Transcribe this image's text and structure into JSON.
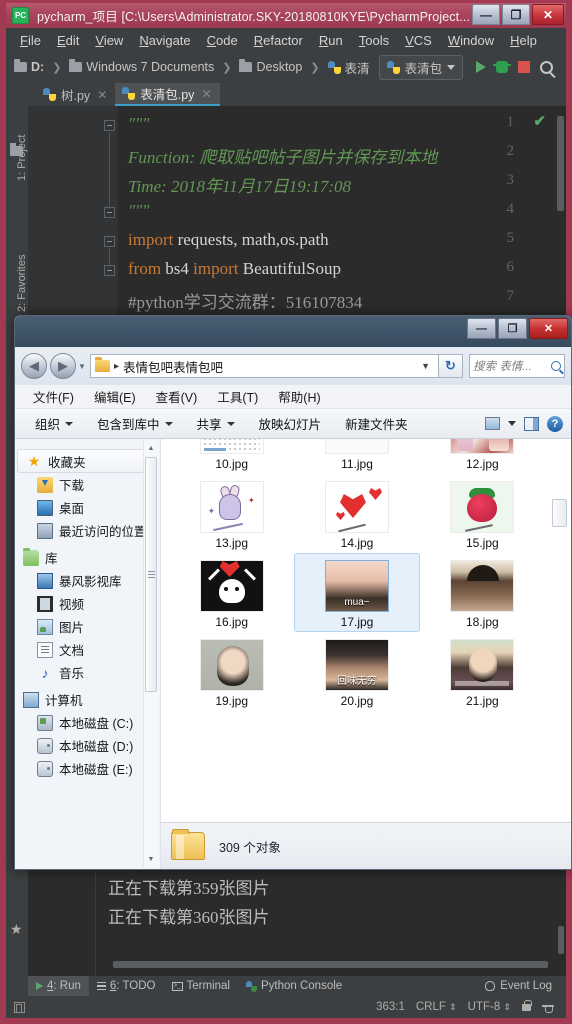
{
  "pycharm": {
    "title": "pycharm_项目 [C:\\Users\\Administrator.SKY-20180810KYE\\PycharmProject...",
    "logo_text": "PC",
    "window_buttons": {
      "minimize": "—",
      "maximize": "❐",
      "close": "✕"
    },
    "menu": [
      "File",
      "Edit",
      "View",
      "Navigate",
      "Code",
      "Refactor",
      "Run",
      "Tools",
      "VCS",
      "Window",
      "Help"
    ],
    "breadcrumbs": [
      "D:",
      "Windows 7 Documents",
      "Desktop",
      "表清"
    ],
    "run_config": "表清包",
    "toolbar_icons": [
      "run-icon",
      "debug-icon",
      "stop-icon",
      "search-everywhere-icon"
    ],
    "tabs": [
      {
        "label": "树.py",
        "active": false
      },
      {
        "label": "表清包.py",
        "active": true
      }
    ],
    "left_strip": {
      "project_label": "1: Project",
      "favorites_label": "2: Favorites"
    },
    "editor": {
      "line_numbers": [
        "1",
        "2",
        "3",
        "4",
        "5",
        "6",
        "7"
      ],
      "lines": [
        {
          "num": "1",
          "segments": [
            {
              "text": "\"\"\"",
              "cls": "c-doc"
            }
          ]
        },
        {
          "num": "2",
          "segments": [
            {
              "text": "Function: 爬取贴吧帖子图片并保存到本地",
              "cls": "c-doc"
            }
          ]
        },
        {
          "num": "3",
          "segments": [
            {
              "text": "Time: 2018年11月17日19:17:08",
              "cls": "c-doc"
            }
          ]
        },
        {
          "num": "4",
          "segments": [
            {
              "text": "\"\"\"",
              "cls": "c-doc"
            }
          ]
        },
        {
          "num": "5",
          "segments": [
            {
              "text": "import",
              "cls": "c-kw"
            },
            {
              "text": " requests, math,os.path",
              "cls": "c-plain"
            }
          ]
        },
        {
          "num": "6",
          "segments": [
            {
              "text": "from",
              "cls": "c-kw"
            },
            {
              "text": " bs4 ",
              "cls": "c-plain"
            },
            {
              "text": "import",
              "cls": "c-kw"
            },
            {
              "text": " BeautifulSoup",
              "cls": "c-plain"
            }
          ]
        },
        {
          "num": "7",
          "segments": [
            {
              "text": "#python学习交流群：516107834",
              "cls": "c-cmt"
            }
          ]
        }
      ],
      "inspection_ok": "✔"
    },
    "console": {
      "lines": [
        "正在下载第359张图片",
        "正在下载第360张图片"
      ]
    },
    "tool_windows": [
      {
        "label": "4: Run",
        "icon": "run-icon",
        "active": true
      },
      {
        "label": "6: TODO",
        "icon": "todo-icon",
        "active": false
      },
      {
        "label": "Terminal",
        "icon": "terminal-icon",
        "active": false
      },
      {
        "label": "Python Console",
        "icon": "python-icon",
        "active": false
      }
    ],
    "event_log": "Event Log",
    "status": {
      "caret": "363:1",
      "line_sep": "CRLF",
      "encoding": "UTF-8",
      "lock_icon": "lock-icon",
      "inspector_icon": "inspection-hat-icon"
    }
  },
  "explorer": {
    "window_buttons": {
      "minimize": "—",
      "maximize": "❐",
      "close": "✕"
    },
    "nav": {
      "back": "◀",
      "forward": "▶",
      "history_caret": "▼",
      "refresh": "↻"
    },
    "address": {
      "folder_icon": "folder-icon",
      "separator": "▸",
      "path": "表情包吧表情包吧",
      "caret": "▼"
    },
    "search": {
      "placeholder": "搜索 表情...",
      "icon": "search-icon"
    },
    "menu": [
      "文件(F)",
      "编辑(E)",
      "查看(V)",
      "工具(T)",
      "帮助(H)"
    ],
    "toolbar": {
      "items": [
        {
          "label": "组织",
          "caret": true
        },
        {
          "label": "包含到库中",
          "caret": true
        },
        {
          "label": "共享",
          "caret": true
        },
        {
          "label": "放映幻灯片",
          "caret": false
        },
        {
          "label": "新建文件夹",
          "caret": false
        }
      ],
      "right_icons": [
        "view-layout-icon",
        "view-caret-icon",
        "preview-pane-icon",
        "help-icon"
      ]
    },
    "sidebar": {
      "groups": [
        {
          "head": {
            "label": "收藏夹",
            "icon": "favorites-star-icon",
            "selected": true
          },
          "items": [
            {
              "label": "下载",
              "icon": "downloads-icon"
            },
            {
              "label": "桌面",
              "icon": "desktop-icon"
            },
            {
              "label": "最近访问的位置",
              "icon": "recent-places-icon"
            }
          ]
        },
        {
          "head": {
            "label": "库",
            "icon": "libraries-icon",
            "selected": false
          },
          "items": [
            {
              "label": "暴风影视库",
              "icon": "baofeng-library-icon"
            },
            {
              "label": "视频",
              "icon": "videos-icon"
            },
            {
              "label": "图片",
              "icon": "pictures-icon"
            },
            {
              "label": "文档",
              "icon": "documents-icon"
            },
            {
              "label": "音乐",
              "icon": "music-icon"
            }
          ]
        },
        {
          "head": {
            "label": "计算机",
            "icon": "computer-icon",
            "selected": false
          },
          "items": [
            {
              "label": "本地磁盘 (C:)",
              "icon": "system-disk-icon"
            },
            {
              "label": "本地磁盘 (D:)",
              "icon": "disk-icon"
            },
            {
              "label": "本地磁盘 (E:)",
              "icon": "disk-icon"
            }
          ]
        }
      ],
      "scroll_up": "▲",
      "scroll_down": "▼"
    },
    "files": [
      {
        "name": "10.jpg",
        "art": "t-cal",
        "selected": false
      },
      {
        "name": "11.jpg",
        "art": "t-line",
        "selected": false
      },
      {
        "name": "12.jpg",
        "art": "t-photo12",
        "selected": false
      },
      {
        "name": "13.jpg",
        "art": "t-rabbit",
        "selected": false
      },
      {
        "name": "14.jpg",
        "art": "t-hearts",
        "selected": false
      },
      {
        "name": "15.jpg",
        "art": "t-straw",
        "selected": false
      },
      {
        "name": "16.jpg",
        "art": "t-panda",
        "selected": false
      },
      {
        "name": "17.jpg",
        "art": "t-girl",
        "selected": true,
        "overlay": "mua~"
      },
      {
        "name": "18.jpg",
        "art": "t-man",
        "selected": false
      },
      {
        "name": "19.jpg",
        "art": "t-woman19",
        "selected": false
      },
      {
        "name": "20.jpg",
        "art": "t-sleep",
        "selected": false,
        "overlay": "回味无穷"
      },
      {
        "name": "21.jpg",
        "art": "t-tv",
        "selected": false
      }
    ],
    "status": {
      "count_text": "309 个对象",
      "folder_icon": "folder-icon"
    }
  },
  "colors": {
    "pycharm_accent": "#a23a52",
    "pycharm_bg": "#3c3f41",
    "editor_bg": "#2b2b2b",
    "docstring_green": "#629755",
    "keyword_orange": "#cc7832",
    "explorer_titlebar": "#41556a",
    "selection_blue": "#e6f0fb"
  }
}
